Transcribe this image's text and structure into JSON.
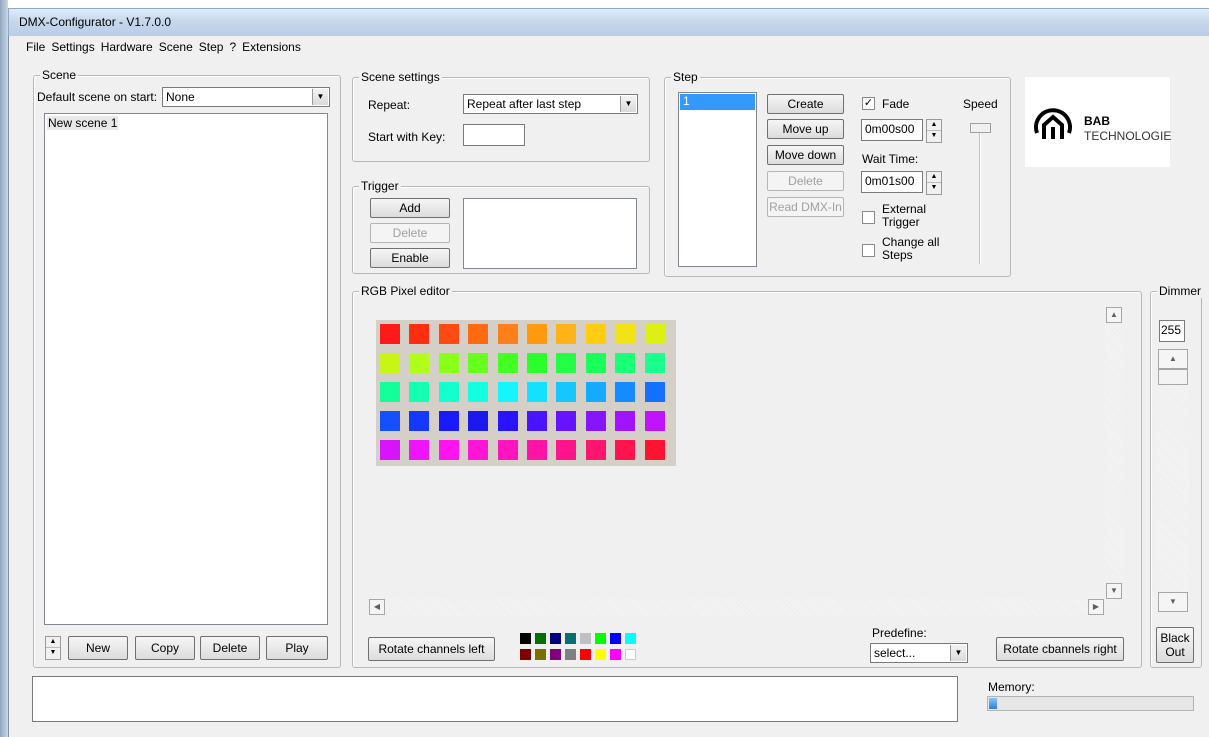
{
  "window": {
    "title": "DMX-Configurator - V1.7.0.0"
  },
  "menu": [
    "File",
    "Settings",
    "Hardware",
    "Scene",
    "Step",
    "?",
    "Extensions"
  ],
  "scene": {
    "group_label": "Scene",
    "default_label": "Default scene on start:",
    "default_value": "None",
    "list": [
      "New scene 1"
    ],
    "buttons": {
      "new": "New",
      "copy": "Copy",
      "delete": "Delete",
      "play": "Play"
    }
  },
  "scene_settings": {
    "group_label": "Scene settings",
    "repeat_label": "Repeat:",
    "repeat_value": "Repeat after last step",
    "start_key_label": "Start with Key:",
    "start_key_value": ""
  },
  "trigger": {
    "group_label": "Trigger",
    "add": "Add",
    "delete": "Delete",
    "enable": "Enable"
  },
  "step": {
    "group_label": "Step",
    "list": [
      "1"
    ],
    "create": "Create",
    "move_up": "Move up",
    "move_down": "Move down",
    "delete": "Delete",
    "read_dmx": "Read DMX-In",
    "fade_label": "Fade",
    "fade_checked": true,
    "fade_time": "0m00s00",
    "wait_label": "Wait Time:",
    "wait_time": "0m01s00",
    "external_trigger_line1": "External",
    "external_trigger_line2": "Trigger",
    "external_trigger_checked": false,
    "change_all_line1": "Change all",
    "change_all_line2": "Steps",
    "change_all_checked": false,
    "speed_label": "Speed"
  },
  "logo": {
    "line1": "BAB",
    "line2": "TECHNOLOGIE"
  },
  "rgb_editor": {
    "group_label": "RGB Pixel editor",
    "pixels": [
      [
        "#ff1a1a",
        "#ff2e10",
        "#ff4a12",
        "#ff6a10",
        "#ff7f1a",
        "#ff9a10",
        "#ffb316",
        "#ffcc10",
        "#f2e414",
        "#dcf014"
      ],
      [
        "#c8f514",
        "#b0ff1a",
        "#8aff1a",
        "#66ff1e",
        "#44ff22",
        "#2dff2d",
        "#22ff44",
        "#1aff5a",
        "#1aff77",
        "#1aff8e"
      ],
      [
        "#14ff9a",
        "#14ffb0",
        "#14ffcc",
        "#14ffe0",
        "#14f5ff",
        "#14e0ff",
        "#14c8ff",
        "#14aaff",
        "#148cff",
        "#1470ff"
      ],
      [
        "#1450ff",
        "#1438ff",
        "#1a1aff",
        "#1a1aee",
        "#2a14ff",
        "#4a14ff",
        "#6614ff",
        "#8614ff",
        "#a014ff",
        "#c014ff"
      ],
      [
        "#d814ff",
        "#ee14ff",
        "#ff14ee",
        "#ff14d8",
        "#ff14c0",
        "#ff14a6",
        "#ff148c",
        "#ff1470",
        "#ff1450",
        "#ff1430"
      ]
    ],
    "rotate_left": "Rotate channels left",
    "rotate_right": "Rotate cbannels right",
    "predefine_label": "Predefine:",
    "predefine_value": "select...",
    "palette_row1": [
      "#000000",
      "#007000",
      "#000080",
      "#007070",
      "#c0c0c0",
      "#00ff00",
      "#0000ff",
      "#00ffff"
    ],
    "palette_row2": [
      "#800000",
      "#7a7000",
      "#800080",
      "#808080",
      "#ff0000",
      "#ffff00",
      "#ff00ff",
      "#ffffff"
    ]
  },
  "dimmer": {
    "group_label": "Dimmer",
    "value": "255",
    "blackout_line1": "Black",
    "blackout_line2": "Out"
  },
  "status": {
    "memory_label": "Memory:",
    "memory_level": 0.04
  },
  "colors": {
    "selection": "#3399ff",
    "title_bg": "#c7d8ec",
    "progress": "#3a8ee6"
  }
}
